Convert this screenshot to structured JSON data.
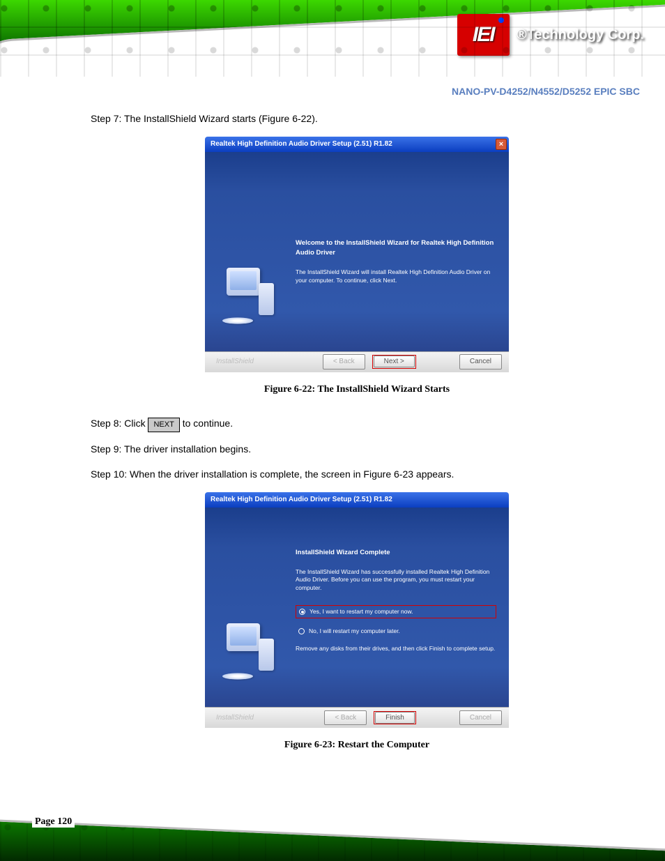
{
  "header": {
    "left": "",
    "right_product": "NANO-PV-D4252/N4552/D5252 EPIC SBC",
    "logo_text": "IEI",
    "company": "®Technology Corp."
  },
  "steps": {
    "step7": "Step 7:  The InstallShield Wizard starts (Figure 6-22).",
    "step8_before": "Step 8:  Click ",
    "step8_btn": "NEXT",
    "step8_after": " to continue.",
    "step9": "Step 9:  The driver installation begins.",
    "step10": "Step 10:  When the driver installation is complete, the screen in Figure 6-23 appears."
  },
  "figcap1": "Figure 6-22: The InstallShield Wizard Starts",
  "figcap2": "Figure 6-23: Restart the Computer",
  "wizard1": {
    "title": "Realtek High Definition Audio Driver Setup (2.51) R1.82",
    "heading": "Welcome to the InstallShield Wizard for Realtek High Definition Audio Driver",
    "para": "The InstallShield Wizard will install Realtek High Definition Audio Driver on your computer. To continue, click Next.",
    "brand": "InstallShield",
    "back": "< Back",
    "next": "Next >",
    "cancel": "Cancel"
  },
  "wizard2": {
    "title": "Realtek High Definition Audio Driver Setup (2.51) R1.82",
    "heading": "InstallShield Wizard Complete",
    "para": "The InstallShield Wizard has successfully installed Realtek High Definition Audio Driver. Before you can use the program, you must restart your computer.",
    "radio_yes": "Yes, I want to restart my computer now.",
    "radio_no": "No, I will restart my computer later.",
    "para2": "Remove any disks from their drives, and then click Finish to complete setup.",
    "brand": "InstallShield",
    "back": "< Back",
    "finish": "Finish",
    "cancel": "Cancel"
  },
  "page_number": "Page 120"
}
